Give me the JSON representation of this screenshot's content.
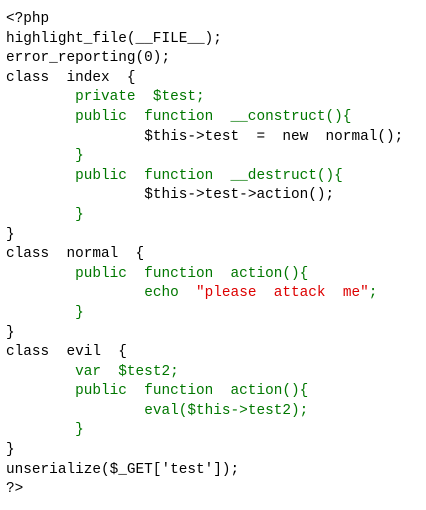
{
  "colors": {
    "background": "#ffffff",
    "plain": "#000000",
    "keyword": "#007700",
    "string": "#dd0000",
    "default": "#0000bb"
  },
  "lines": [
    [
      {
        "t": "<?php",
        "c": "plain"
      }
    ],
    [
      {
        "t": "highlight_file(__FILE__);",
        "c": "plain"
      }
    ],
    [
      {
        "t": "error_reporting(0);",
        "c": "plain"
      }
    ],
    [
      {
        "t": "class  index  {",
        "c": "plain"
      }
    ],
    [
      {
        "t": "        ",
        "c": "plain"
      },
      {
        "t": "private  $test;",
        "c": "keyword"
      }
    ],
    [
      {
        "t": "        ",
        "c": "plain"
      },
      {
        "t": "public  function  __construct(){",
        "c": "keyword"
      }
    ],
    [
      {
        "t": "                ",
        "c": "plain"
      },
      {
        "t": "$this->test  =  new  normal();",
        "c": "plain"
      }
    ],
    [
      {
        "t": "        ",
        "c": "plain"
      },
      {
        "t": "}",
        "c": "keyword"
      }
    ],
    [
      {
        "t": "        ",
        "c": "plain"
      },
      {
        "t": "public  function  __destruct(){",
        "c": "keyword"
      }
    ],
    [
      {
        "t": "                ",
        "c": "plain"
      },
      {
        "t": "$this->test->action();",
        "c": "plain"
      }
    ],
    [
      {
        "t": "        ",
        "c": "plain"
      },
      {
        "t": "}",
        "c": "keyword"
      }
    ],
    [
      {
        "t": "}",
        "c": "plain"
      }
    ],
    [
      {
        "t": "class  normal  {",
        "c": "plain"
      }
    ],
    [
      {
        "t": "        ",
        "c": "plain"
      },
      {
        "t": "public  function  action(){",
        "c": "keyword"
      }
    ],
    [
      {
        "t": "                ",
        "c": "plain"
      },
      {
        "t": "echo  ",
        "c": "keyword"
      },
      {
        "t": "\"please  attack  me\"",
        "c": "string"
      },
      {
        "t": ";",
        "c": "keyword"
      }
    ],
    [
      {
        "t": "        ",
        "c": "plain"
      },
      {
        "t": "}",
        "c": "keyword"
      }
    ],
    [
      {
        "t": "}",
        "c": "plain"
      }
    ],
    [
      {
        "t": "class  evil  {",
        "c": "plain"
      }
    ],
    [
      {
        "t": "        ",
        "c": "plain"
      },
      {
        "t": "var  $test2;",
        "c": "keyword"
      }
    ],
    [
      {
        "t": "        ",
        "c": "plain"
      },
      {
        "t": "public  function  action(){",
        "c": "keyword"
      }
    ],
    [
      {
        "t": "                ",
        "c": "plain"
      },
      {
        "t": "eval($this->test2);",
        "c": "keyword"
      }
    ],
    [
      {
        "t": "        ",
        "c": "plain"
      },
      {
        "t": "}",
        "c": "keyword"
      }
    ],
    [
      {
        "t": "}",
        "c": "plain"
      }
    ],
    [
      {
        "t": "unserialize($_GET['test']);",
        "c": "plain"
      }
    ],
    [
      {
        "t": "?>",
        "c": "plain"
      }
    ]
  ]
}
